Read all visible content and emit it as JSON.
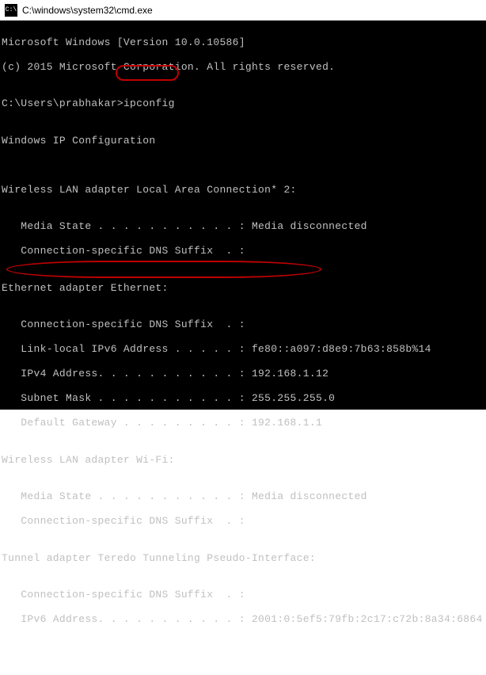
{
  "title": "C:\\windows\\system32\\cmd.exe",
  "icon_glyph": "C:\\",
  "lines": {
    "l0": "Microsoft Windows [Version 10.0.10586]",
    "l1": "(c) 2015 Microsoft Corporation. All rights reserved.",
    "l2": "",
    "l3_prompt": "C:\\Users\\prabhakar>",
    "l3_cmd": "ipconfig",
    "l4": "",
    "l5": "Windows IP Configuration",
    "l6": "",
    "l7": "",
    "l8": "Wireless LAN adapter Local Area Connection* 2:",
    "l9": "",
    "l10": "   Media State . . . . . . . . . . . : Media disconnected",
    "l11": "   Connection-specific DNS Suffix  . :",
    "l12": "",
    "l13": "Ethernet adapter Ethernet:",
    "l14": "",
    "l15": "   Connection-specific DNS Suffix  . :",
    "l16": "   Link-local IPv6 Address . . . . . : fe80::a097:d8e9:7b63:858b%14",
    "l17": "   IPv4 Address. . . . . . . . . . . : 192.168.1.12",
    "l18": "   Subnet Mask . . . . . . . . . . . : 255.255.255.0",
    "l19": "   Default Gateway . . . . . . . . . : 192.168.1.1",
    "l20": "",
    "l21": "Wireless LAN adapter Wi-Fi:",
    "l22": "",
    "l23": "   Media State . . . . . . . . . . . : Media disconnected",
    "l24": "   Connection-specific DNS Suffix  . :",
    "l25": "",
    "l26": "Tunnel adapter Teredo Tunneling Pseudo-Interface:",
    "l27": "",
    "l28": "   Connection-specific DNS Suffix  . :",
    "l29": "   IPv6 Address. . . . . . . . . . . : 2001:0:5ef5:79fb:2c17:c72b:8a34:6864"
  }
}
